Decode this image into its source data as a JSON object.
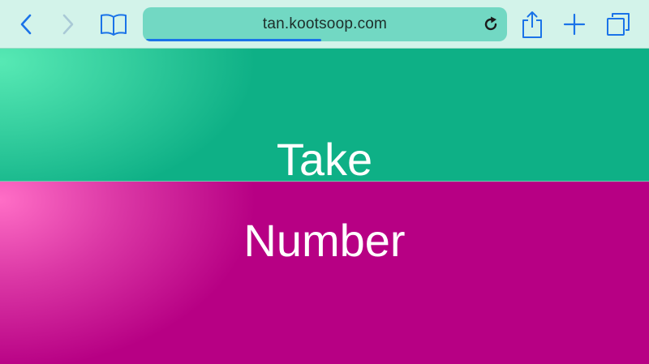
{
  "browser": {
    "url": "tan.kootsoop.com",
    "load_progress": 0.48,
    "accent_color": "#1a73e8",
    "icons": {
      "back": "chevron-left-icon",
      "forward": "chevron-right-icon",
      "bookmarks": "book-icon",
      "reload": "reload-icon",
      "share": "share-icon",
      "new_tab": "plus-icon",
      "tabs": "tabs-icon"
    }
  },
  "page": {
    "top_panel": {
      "label": "Take",
      "color": "#0eb086"
    },
    "bottom_panel": {
      "label": "Number",
      "color": "#b70084"
    }
  }
}
